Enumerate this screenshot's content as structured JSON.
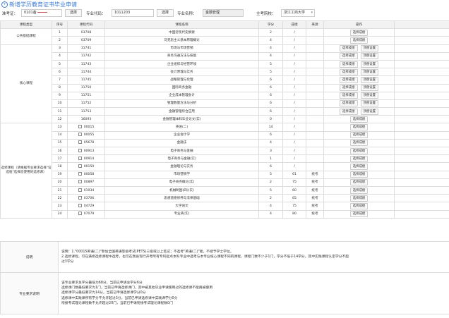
{
  "page": {
    "title": "新增学历教育证书毕业申请"
  },
  "form": {
    "exam_no_label": "准考证：",
    "exam_no_value": "0101备",
    "select_button": "选择",
    "major_code_label": "专业代码：",
    "major_code_value": "1011203",
    "major_select_button": "选择",
    "major_name_label": "专业名称：",
    "major_name_value": "金融管理",
    "school_label": "主考院校：",
    "school_value": "浙江工商大学"
  },
  "table": {
    "headers": [
      "课程类型",
      "序号",
      "课程代码",
      "课程名称",
      "学分",
      "成绩",
      "来源",
      "操作"
    ],
    "btn_select_score": "选择成绩",
    "btn_top_setting": "顶替设置",
    "groups": {
      "public": "公共基础课程",
      "core": "核心课程",
      "elective": "选修课程（请根据专业要求选择\"勾选框\"选择您使用的选修课）"
    },
    "rows": [
      {
        "no": "1",
        "code": "03708",
        "name": "中国近现代史纲要",
        "credit": "2",
        "score": "/",
        "source": "",
        "cb": false,
        "top": false
      },
      {
        "no": "2",
        "code": "03709",
        "name": "马克思主义基本原理概论",
        "credit": "4",
        "score": "/",
        "source": "",
        "cb": false,
        "top": false
      },
      {
        "no": "3",
        "code": "11741",
        "name": "市场与市场营销",
        "credit": "4",
        "score": "/",
        "source": "",
        "cb": false,
        "top": true
      },
      {
        "no": "4",
        "code": "11742",
        "name": "商务沟通方法与技能",
        "credit": "4",
        "score": "/",
        "source": "",
        "cb": false,
        "top": true
      },
      {
        "no": "5",
        "code": "11743",
        "name": "企业组织与经营环境",
        "credit": "5",
        "score": "/",
        "source": "",
        "cb": false,
        "top": true
      },
      {
        "no": "6",
        "code": "11744",
        "name": "会计原理与实务",
        "credit": "5",
        "score": "/",
        "source": "",
        "cb": false,
        "top": true
      },
      {
        "no": "7",
        "code": "11745",
        "name": "战略管理与伦理",
        "credit": "6",
        "score": "/",
        "source": "",
        "cb": false,
        "top": true
      },
      {
        "no": "8",
        "code": "11750",
        "name": "国际商务金融",
        "credit": "6",
        "score": "/",
        "source": "",
        "cb": false,
        "top": true
      },
      {
        "no": "9",
        "code": "11751",
        "name": "企业成本管理会计",
        "credit": "6",
        "score": "/",
        "source": "",
        "cb": false,
        "top": true
      },
      {
        "no": "10",
        "code": "11752",
        "name": "管理数量方法与分析",
        "credit": "6",
        "score": "/",
        "source": "",
        "cb": false,
        "top": true
      },
      {
        "no": "11",
        "code": "11753",
        "name": "金融管理综合应用",
        "credit": "6",
        "score": "/",
        "source": "",
        "cb": false,
        "top": true
      },
      {
        "no": "12",
        "code": "16093",
        "name": "金融管理本科毕业论文(实)",
        "credit": "0",
        "score": "/",
        "source": "",
        "cb": false,
        "top": false
      },
      {
        "no": "13",
        "code": "00015",
        "name": "英语(二)",
        "credit": "14",
        "score": "/",
        "source": "",
        "cb": true,
        "top": false
      },
      {
        "no": "14",
        "code": "00055",
        "name": "企业会计学",
        "credit": "6",
        "score": "/",
        "source": "",
        "cb": true,
        "top": false
      },
      {
        "no": "15",
        "code": "05678",
        "name": "金融法",
        "credit": "4",
        "score": "/",
        "source": "",
        "cb": true,
        "top": false
      },
      {
        "no": "16",
        "code": "00913",
        "name": "电子商务与金融",
        "credit": "3",
        "score": "/",
        "source": "",
        "cb": true,
        "top": false
      },
      {
        "no": "17",
        "code": "00914",
        "name": "电子商务与金融(实)",
        "credit": "1",
        "score": "/",
        "source": "",
        "cb": true,
        "top": false
      },
      {
        "no": "18",
        "code": "00150",
        "name": "金融理论与实务",
        "credit": "6",
        "score": "/",
        "source": "",
        "cb": true,
        "top": false
      },
      {
        "no": "19",
        "code": "00058",
        "name": "市场营销学",
        "credit": "5",
        "score": "61",
        "source": "统考",
        "cb": true,
        "top": false
      },
      {
        "no": "20",
        "code": "00897",
        "name": "电子商务概论(实)",
        "credit": "2",
        "score": "75",
        "source": "统考",
        "cb": true,
        "top": false
      },
      {
        "no": "21",
        "code": "01934",
        "name": "机械制图(四)(实)",
        "credit": "5",
        "score": "60",
        "source": "统考",
        "cb": true,
        "top": false
      },
      {
        "no": "22",
        "code": "03706",
        "name": "思想道德修养与法律基础",
        "credit": "2",
        "score": "65",
        "source": "统考",
        "cb": true,
        "top": false
      },
      {
        "no": "23",
        "code": "04729",
        "name": "大学语文",
        "credit": "4",
        "score": "75",
        "source": "统考",
        "cb": true,
        "top": false
      },
      {
        "no": "24",
        "code": "07079",
        "name": "专业英(实)",
        "credit": "4",
        "score": "80",
        "source": "统考",
        "cb": true,
        "top": false
      }
    ]
  },
  "notes": {
    "desc_label": "说明",
    "desc_lines": [
      "说明：1.\"00015英语(二)\"参加全国英语等级考试(PETS)三级或以上笔试；不选考\"英语(二)\"者，不授予学士学位。",
      "2.选修课程，可在满修选修课程中选考，也可在我省现行开考所有专科起点本科专业中选考与本专业核心课程不同的课程，课程门数不少于1门，学分不低于14学分。其中实践课程认定学分不超",
      "过3学分"
    ],
    "req_label": "专业要求说明",
    "req_lines": [
      "该专业要求总学分最低为68分，当前已申请总学分6分",
      "选修课门数最低要求为1门，当前已申请选修课门，其中被其他毕业申请使用过的选修课不能再被使用",
      "选修课学分最低要求为14分，当前已申请选修课学分0分",
      "选修课中实践课所有学分不允许超过3分，当前已申请选修课中实践课学分0分",
      "衔接考试理论课程数不允许超过20门，当前已申请衔接考试理论课程数0门"
    ]
  }
}
